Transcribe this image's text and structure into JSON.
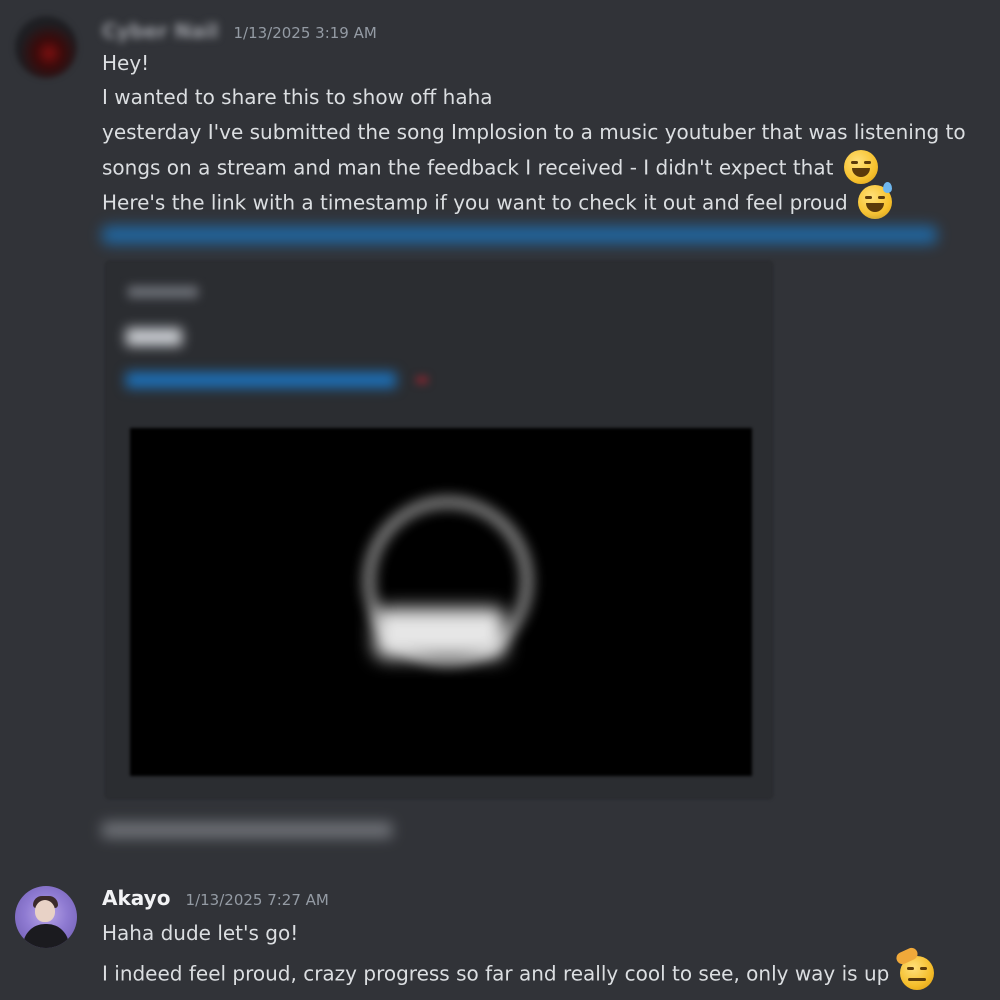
{
  "messages": [
    {
      "username": "Cyber Nail",
      "timestamp": "1/13/2025 3:19 AM",
      "lines": [
        "Hey!",
        "I wanted to share this to show off haha",
        "yesterday I've submitted the song Implosion to a music youtuber that was listening to",
        "songs on a stream and man the feedback I received - I didn't expect that",
        "Here's the link with a timestamp if you want to check it out and feel proud"
      ],
      "emojis": [
        "laughing-emoji",
        "sweat-smile-emoji"
      ]
    },
    {
      "username": "Akayo",
      "timestamp": "1/13/2025 7:27 AM",
      "lines": [
        "Haha dude let's go!",
        "I indeed feel proud, crazy progress so far and really cool to see, only way is up"
      ],
      "emojis": [
        "saluting-emoji"
      ]
    }
  ],
  "colors": {
    "background": "#313338",
    "text": "#dbdee1",
    "timestamp": "#949ba4",
    "username": "#f2f3f5",
    "link": "#00a8fc",
    "embed_background": "#2b2d31"
  }
}
